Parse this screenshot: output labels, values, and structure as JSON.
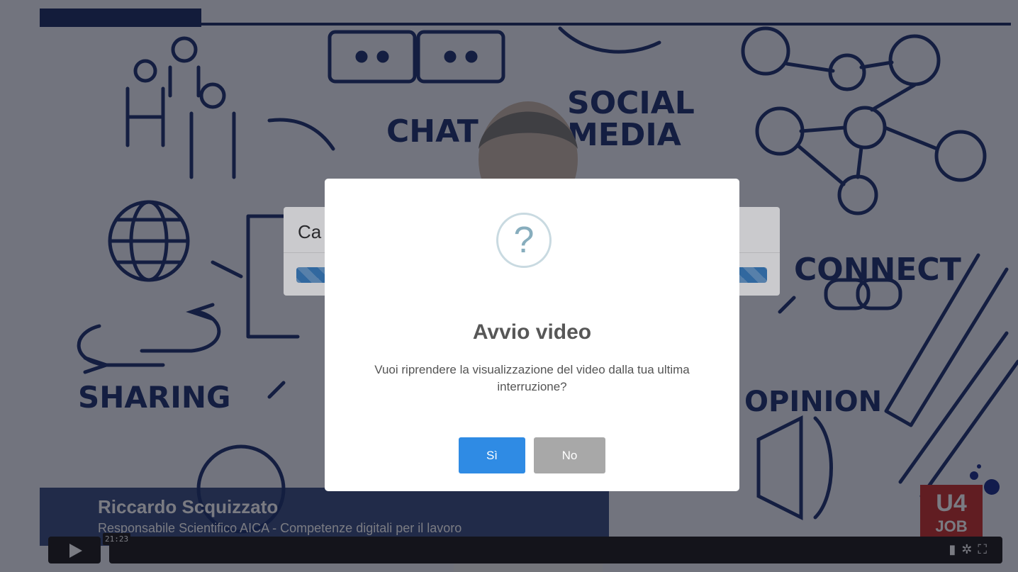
{
  "video": {
    "presenter_name": "Riccardo Scquizzato",
    "presenter_role": "Responsabile Scientifico AICA - Competenze digitali per il lavoro",
    "time_display": "21:23",
    "logo_top": "U4",
    "logo_bottom": "JOB",
    "background_words": [
      "CHAT",
      "SOCIAL",
      "MEDIA",
      "CONNECT",
      "SHARING",
      "OPINION"
    ]
  },
  "loading_dialog": {
    "title_visible": "Ca",
    "progress_bar": "striped-active"
  },
  "dialog": {
    "icon": "question-icon",
    "icon_glyph": "?",
    "title": "Avvio video",
    "message": "Vuoi riprendere la visualizzazione del video dalla tua ultima interruzione?",
    "confirm_label": "Sì",
    "cancel_label": "No"
  },
  "controls": {
    "play_icon": "play-icon",
    "right_icons": [
      "volume-icon",
      "settings-icon",
      "fullscreen-icon"
    ]
  },
  "colors": {
    "accent": "#2f8be4",
    "cancel": "#a8a8a8",
    "navy": "#1d2f63",
    "logo_red": "#c8312c"
  }
}
